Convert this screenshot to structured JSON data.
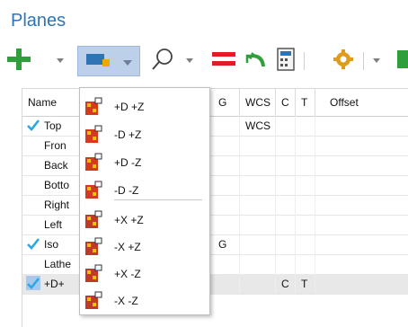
{
  "title": "Planes",
  "grid": {
    "columns": [
      "Name",
      "G",
      "WCS",
      "C",
      "T",
      "Offset"
    ],
    "rows": [
      {
        "name": "Top",
        "checked": true,
        "g": "",
        "wcs": "WCS",
        "c": "",
        "t": ""
      },
      {
        "name": "Fron",
        "checked": false,
        "g": "",
        "wcs": "",
        "c": "",
        "t": ""
      },
      {
        "name": "Back",
        "checked": false,
        "g": "",
        "wcs": "",
        "c": "",
        "t": ""
      },
      {
        "name": "Botto",
        "checked": false,
        "g": "",
        "wcs": "",
        "c": "",
        "t": ""
      },
      {
        "name": "Right",
        "checked": false,
        "g": "",
        "wcs": "",
        "c": "",
        "t": ""
      },
      {
        "name": "Left",
        "checked": false,
        "g": "",
        "wcs": "",
        "c": "",
        "t": ""
      },
      {
        "name": "Iso",
        "checked": true,
        "g": "G",
        "wcs": "",
        "c": "",
        "t": ""
      },
      {
        "name": "Lathe",
        "checked": false,
        "g": "",
        "wcs": "",
        "c": "",
        "t": ""
      },
      {
        "name": "+D+",
        "checked": true,
        "g": "",
        "wcs": "",
        "c": "C",
        "t": "T"
      }
    ]
  },
  "menu": {
    "group1": [
      "+D +Z",
      "-D +Z",
      "+D -Z",
      "-D -Z"
    ],
    "group2": [
      "+X +Z",
      "-X +Z",
      "+X -Z",
      "-X -Z"
    ]
  }
}
